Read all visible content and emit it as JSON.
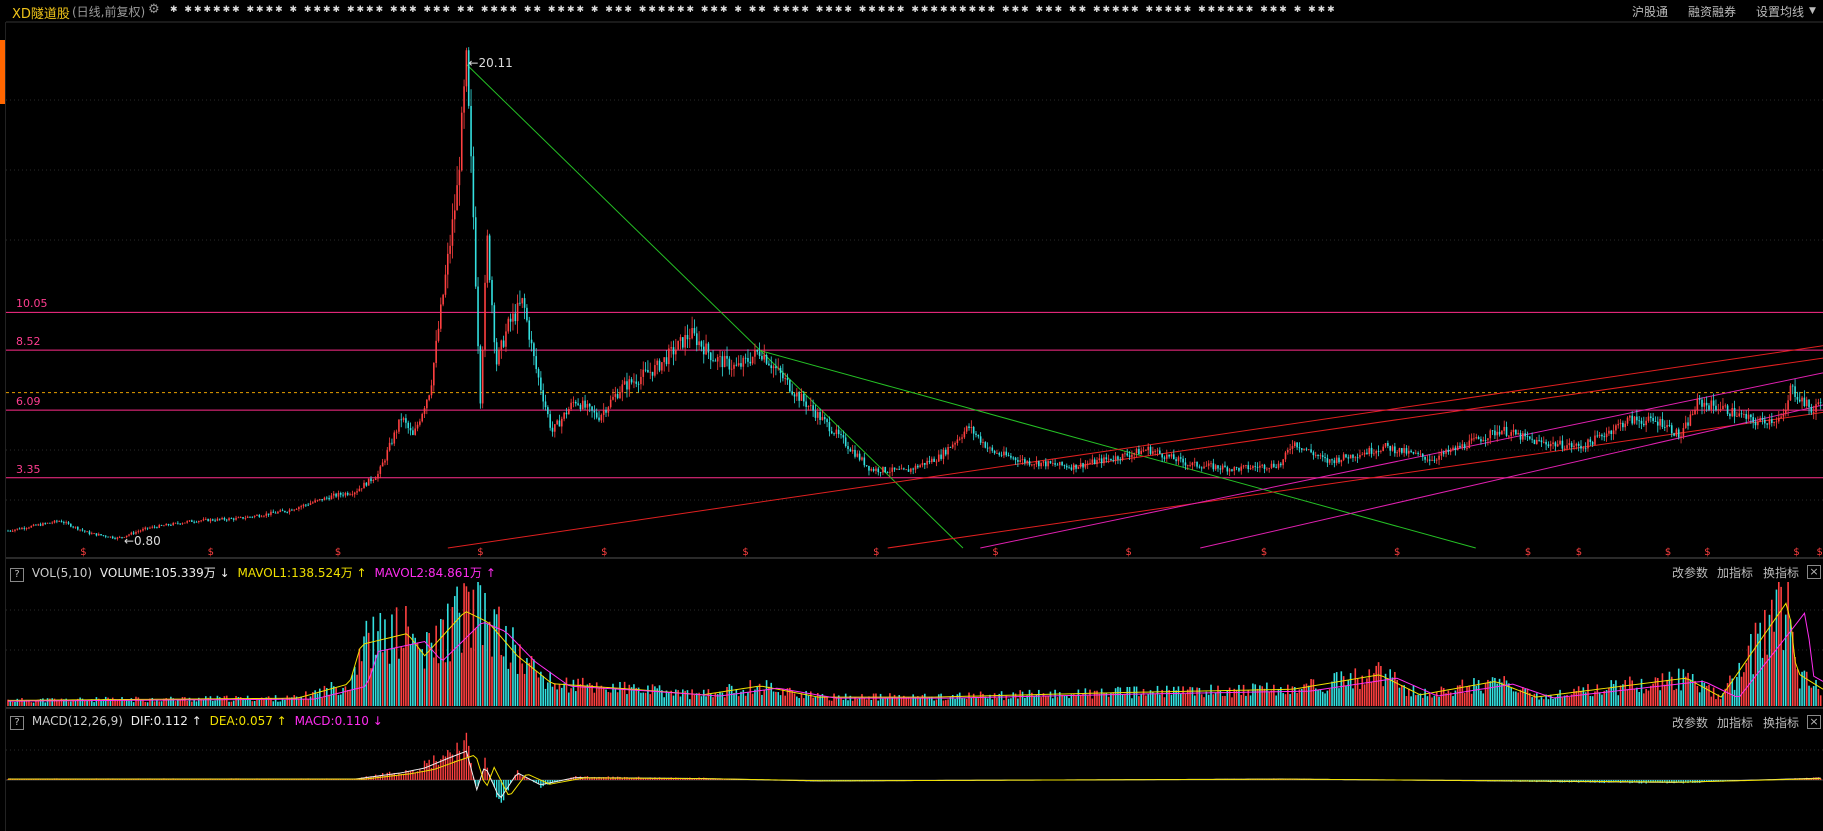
{
  "header": {
    "stock_name": "XD隧道股",
    "mode": "(日线,前复权)",
    "ticker_text": "✱  ✱✱✱✱✱✱  ✱✱✱✱  ✱  ✱✱✱✱  ✱✱✱✱  ✱✱✱  ✱✱✱  ✱✱  ✱✱✱✱  ✱✱  ✱✱✱✱  ✱  ✱✱✱  ✱✱✱✱✱✱  ✱✱✱  ✱  ✱✱  ✱✱✱✱  ✱✱✱✱  ✱✱✱✱✱  ✱✱✱✱✱✱✱✱✱  ✱✱✱  ✱✱✱  ✱✱  ✱✱✱✱✱  ✱✱✱✱✱  ✱✱✱✱✱✱  ✱✱✱  ✱  ✱✱✱",
    "links": [
      "沪股通",
      "融资融券",
      "设置均线"
    ]
  },
  "price_panel": {
    "high_label": "20.11",
    "low_label": "0.80",
    "levels": [
      {
        "label": "10.05",
        "value": 10.05
      },
      {
        "label": "8.52",
        "value": 8.52
      },
      {
        "label": "6.09",
        "value": 6.09
      },
      {
        "label": "3.35",
        "value": 3.35
      }
    ],
    "current_price_line": 6.8,
    "dividend_marker": "$"
  },
  "volume_panel": {
    "name": "VOL(5,10)",
    "volume": "VOLUME:105.339万 ↓",
    "mavol1": "MAVOL1:138.524万 ↑",
    "mavol2": "MAVOL2:84.861万 ↑",
    "buttons": [
      "改参数",
      "加指标",
      "换指标"
    ]
  },
  "macd_panel": {
    "name": "MACD(12,26,9)",
    "dif": "DIF:0.112 ↑",
    "dea": "DEA:0.057 ↑",
    "macd": "MACD:0.110 ↓",
    "buttons": [
      "改参数",
      "加指标",
      "换指标"
    ]
  },
  "colors": {
    "up": "#ff4040",
    "down": "#33e0e0",
    "level_line": "#ff2d8a",
    "green_trend": "#25c025",
    "red_trend": "#e02020",
    "magenta_trend": "#e020b0",
    "dashed_price": "#e8a000",
    "mavol1": "#f0e000",
    "mavol2": "#ff2df0"
  },
  "chart_data": {
    "type": "line",
    "price_anchors": [
      [
        0,
        1.2
      ],
      [
        45,
        1.6
      ],
      [
        70,
        1.1
      ],
      [
        95,
        0.9
      ],
      [
        120,
        1.3
      ],
      [
        160,
        1.6
      ],
      [
        200,
        1.7
      ],
      [
        240,
        2.0
      ],
      [
        280,
        2.6
      ],
      [
        300,
        2.8
      ],
      [
        320,
        3.5
      ],
      [
        340,
        5.8
      ],
      [
        350,
        5.0
      ],
      [
        365,
        7.0
      ],
      [
        378,
        11.5
      ],
      [
        388,
        15.0
      ],
      [
        396,
        20.11
      ],
      [
        402,
        14.0
      ],
      [
        408,
        6.5
      ],
      [
        414,
        13.0
      ],
      [
        422,
        8.0
      ],
      [
        432,
        9.5
      ],
      [
        445,
        10.5
      ],
      [
        455,
        8.0
      ],
      [
        470,
        5.2
      ],
      [
        490,
        6.5
      ],
      [
        510,
        5.8
      ],
      [
        530,
        7.0
      ],
      [
        560,
        7.8
      ],
      [
        590,
        9.2
      ],
      [
        610,
        8.2
      ],
      [
        630,
        7.8
      ],
      [
        650,
        8.5
      ],
      [
        680,
        6.8
      ],
      [
        710,
        5.4
      ],
      [
        745,
        3.7
      ],
      [
        775,
        3.6
      ],
      [
        805,
        4.2
      ],
      [
        830,
        5.4
      ],
      [
        850,
        4.4
      ],
      [
        880,
        4.0
      ],
      [
        920,
        3.8
      ],
      [
        960,
        4.2
      ],
      [
        985,
        4.5
      ],
      [
        1020,
        3.9
      ],
      [
        1060,
        3.7
      ],
      [
        1100,
        3.9
      ],
      [
        1110,
        4.8
      ],
      [
        1140,
        4.0
      ],
      [
        1190,
        4.6
      ],
      [
        1230,
        4.1
      ],
      [
        1290,
        5.3
      ],
      [
        1320,
        4.8
      ],
      [
        1360,
        4.6
      ],
      [
        1400,
        5.7
      ],
      [
        1430,
        5.6
      ],
      [
        1445,
        5.0
      ],
      [
        1460,
        6.4
      ],
      [
        1480,
        6.2
      ],
      [
        1510,
        5.6
      ],
      [
        1535,
        5.8
      ],
      [
        1540,
        7.0
      ],
      [
        1560,
        6.0
      ],
      [
        1568,
        6.8
      ]
    ],
    "vol_anchors": [
      [
        0,
        0.05
      ],
      [
        250,
        0.07
      ],
      [
        295,
        0.2
      ],
      [
        305,
        0.55
      ],
      [
        345,
        0.65
      ],
      [
        360,
        0.45
      ],
      [
        395,
        0.85
      ],
      [
        415,
        0.75
      ],
      [
        440,
        0.45
      ],
      [
        470,
        0.2
      ],
      [
        540,
        0.15
      ],
      [
        600,
        0.1
      ],
      [
        650,
        0.18
      ],
      [
        700,
        0.08
      ],
      [
        800,
        0.08
      ],
      [
        960,
        0.12
      ],
      [
        1110,
        0.15
      ],
      [
        1185,
        0.28
      ],
      [
        1220,
        0.1
      ],
      [
        1285,
        0.22
      ],
      [
        1320,
        0.08
      ],
      [
        1450,
        0.25
      ],
      [
        1480,
        0.08
      ],
      [
        1538,
        0.95
      ],
      [
        1545,
        0.3
      ],
      [
        1568,
        0.15
      ]
    ],
    "macd_anchors": [
      [
        0,
        0.02
      ],
      [
        300,
        0.02
      ],
      [
        340,
        0.15
      ],
      [
        360,
        0.25
      ],
      [
        380,
        0.45
      ],
      [
        396,
        0.6
      ],
      [
        405,
        -0.2
      ],
      [
        412,
        0.3
      ],
      [
        425,
        -0.4
      ],
      [
        440,
        0.15
      ],
      [
        460,
        -0.1
      ],
      [
        490,
        0.05
      ],
      [
        600,
        0.03
      ],
      [
        700,
        -0.02
      ],
      [
        1100,
        0.02
      ],
      [
        1440,
        -0.05
      ],
      [
        1568,
        0.04
      ]
    ],
    "dividend_x": [
      65,
      175,
      285,
      408,
      515,
      637,
      750,
      853,
      968,
      1085,
      1200,
      1313,
      1357,
      1434,
      1468,
      1545,
      1565
    ],
    "xlim": [
      0,
      1568
    ],
    "ylim": [
      0.5,
      21.5
    ]
  }
}
